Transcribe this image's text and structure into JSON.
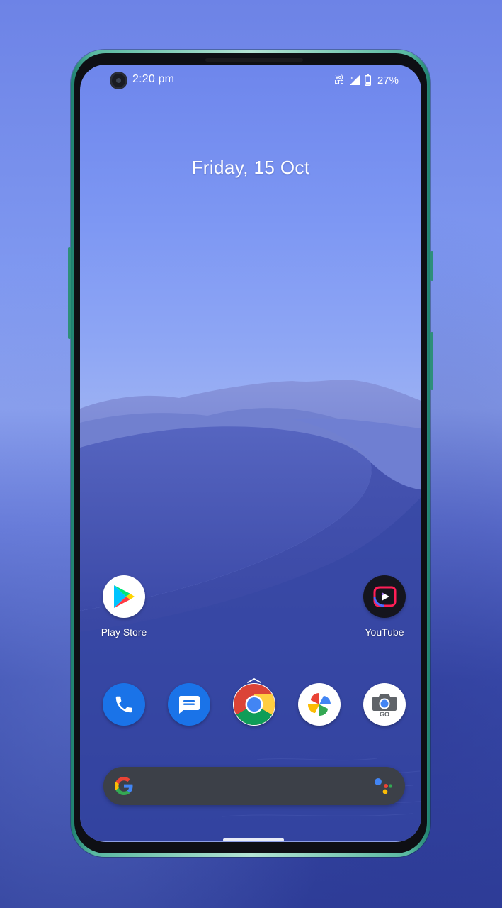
{
  "status_bar": {
    "time": "2:20 pm",
    "network_label_top": "Vo)",
    "network_label_bottom": "LTE",
    "battery_percent": "27%"
  },
  "home": {
    "date": "Friday, 15 Oct"
  },
  "apps": [
    {
      "name": "play-store",
      "label": "Play Store"
    },
    {
      "name": "youtube",
      "label": "YouTube"
    }
  ],
  "dock": [
    {
      "name": "phone",
      "icon": "phone-icon"
    },
    {
      "name": "messages",
      "icon": "message-icon"
    },
    {
      "name": "chrome",
      "icon": "chrome-icon"
    },
    {
      "name": "photos",
      "icon": "photos-icon"
    },
    {
      "name": "camera-go",
      "icon": "camera-icon",
      "badge": "GO"
    }
  ],
  "search": {
    "logo": "google-g-icon",
    "assistant": "google-assistant-icon"
  },
  "colors": {
    "phone_blue": "#1a73e8",
    "messages_blue": "#1a73e8",
    "search_bar": "#3c4048"
  }
}
